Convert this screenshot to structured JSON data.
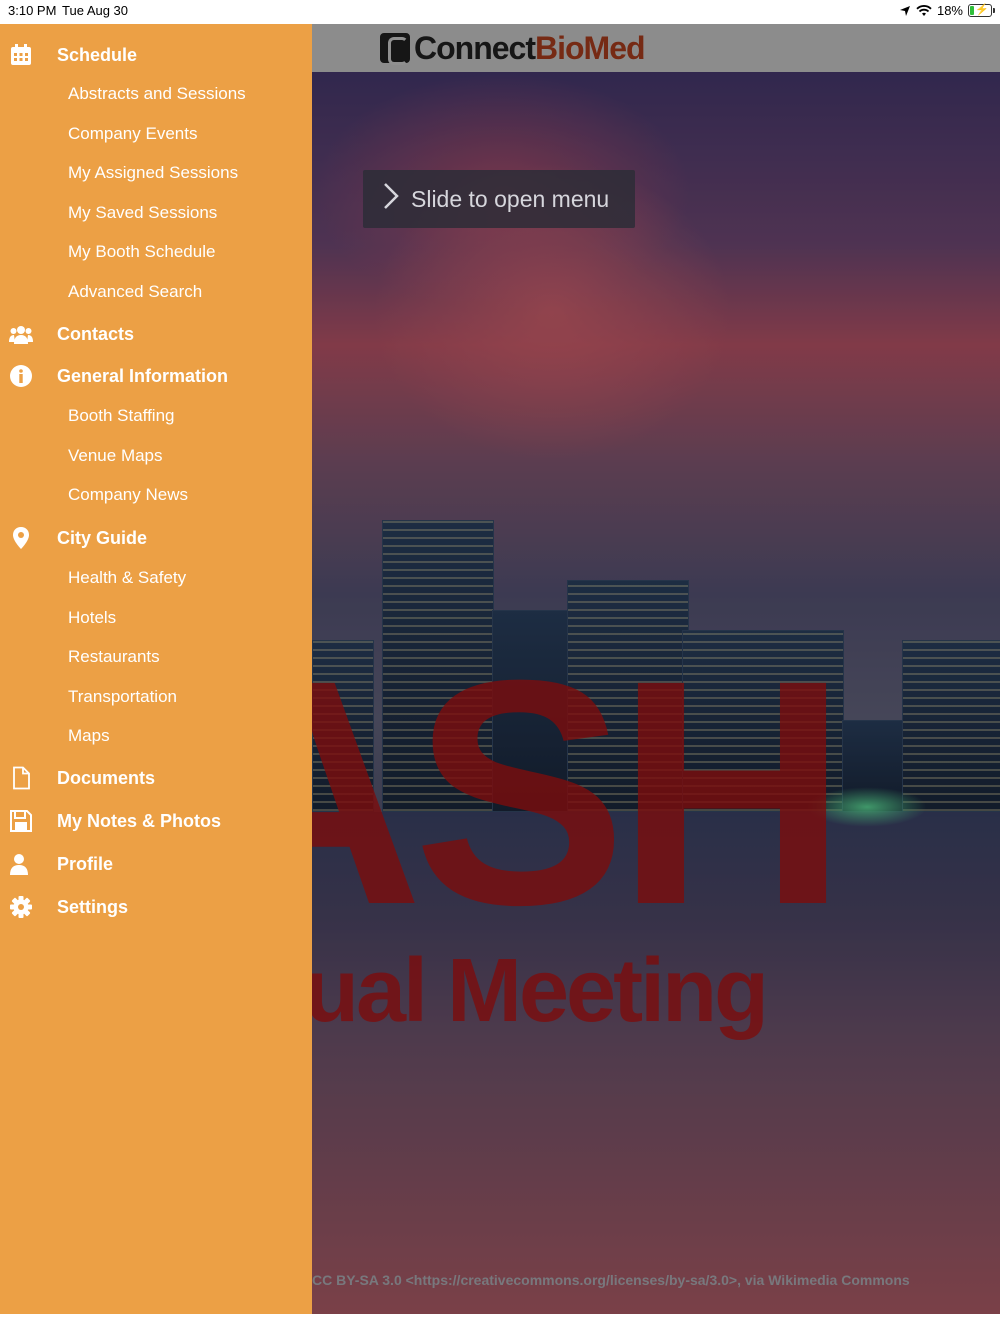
{
  "status_bar": {
    "time": "3:10 PM",
    "date": "Tue Aug 30",
    "battery": "18%",
    "icons": [
      "location-arrow-icon",
      "wifi-icon",
      "battery-charging-icon"
    ]
  },
  "header": {
    "logo_part1": "Connect",
    "logo_part2": "BioMed"
  },
  "slide_hint": {
    "label": "Slide to open menu"
  },
  "hero": {
    "big_text": "ASH",
    "sub_text": "nual Meeting",
    "credit": "CC BY-SA 3.0 <https://creativecommons.org/licenses/by-sa/3.0>, via Wikimedia Commons"
  },
  "menu": {
    "schedule": {
      "label": "Schedule",
      "icon": "calendar-icon",
      "items": [
        "Abstracts and Sessions",
        "Company Events",
        "My Assigned Sessions",
        "My Saved Sessions",
        "My Booth Schedule",
        "Advanced Search"
      ]
    },
    "contacts": {
      "label": "Contacts",
      "icon": "users-icon"
    },
    "general_information": {
      "label": "General Information",
      "icon": "info-icon",
      "items": [
        "Booth Staffing",
        "Venue Maps",
        "Company News"
      ]
    },
    "city_guide": {
      "label": "City Guide",
      "icon": "map-pin-icon",
      "items": [
        "Health & Safety",
        "Hotels",
        "Restaurants",
        "Transportation",
        "Maps"
      ]
    },
    "documents": {
      "label": "Documents",
      "icon": "document-icon"
    },
    "notes_photos": {
      "label": "My Notes & Photos",
      "icon": "save-icon"
    },
    "profile": {
      "label": "Profile",
      "icon": "user-icon"
    },
    "settings": {
      "label": "Settings",
      "icon": "gear-icon"
    }
  },
  "colors": {
    "drawer": "#eca045",
    "menu_text": "#ffffff"
  }
}
